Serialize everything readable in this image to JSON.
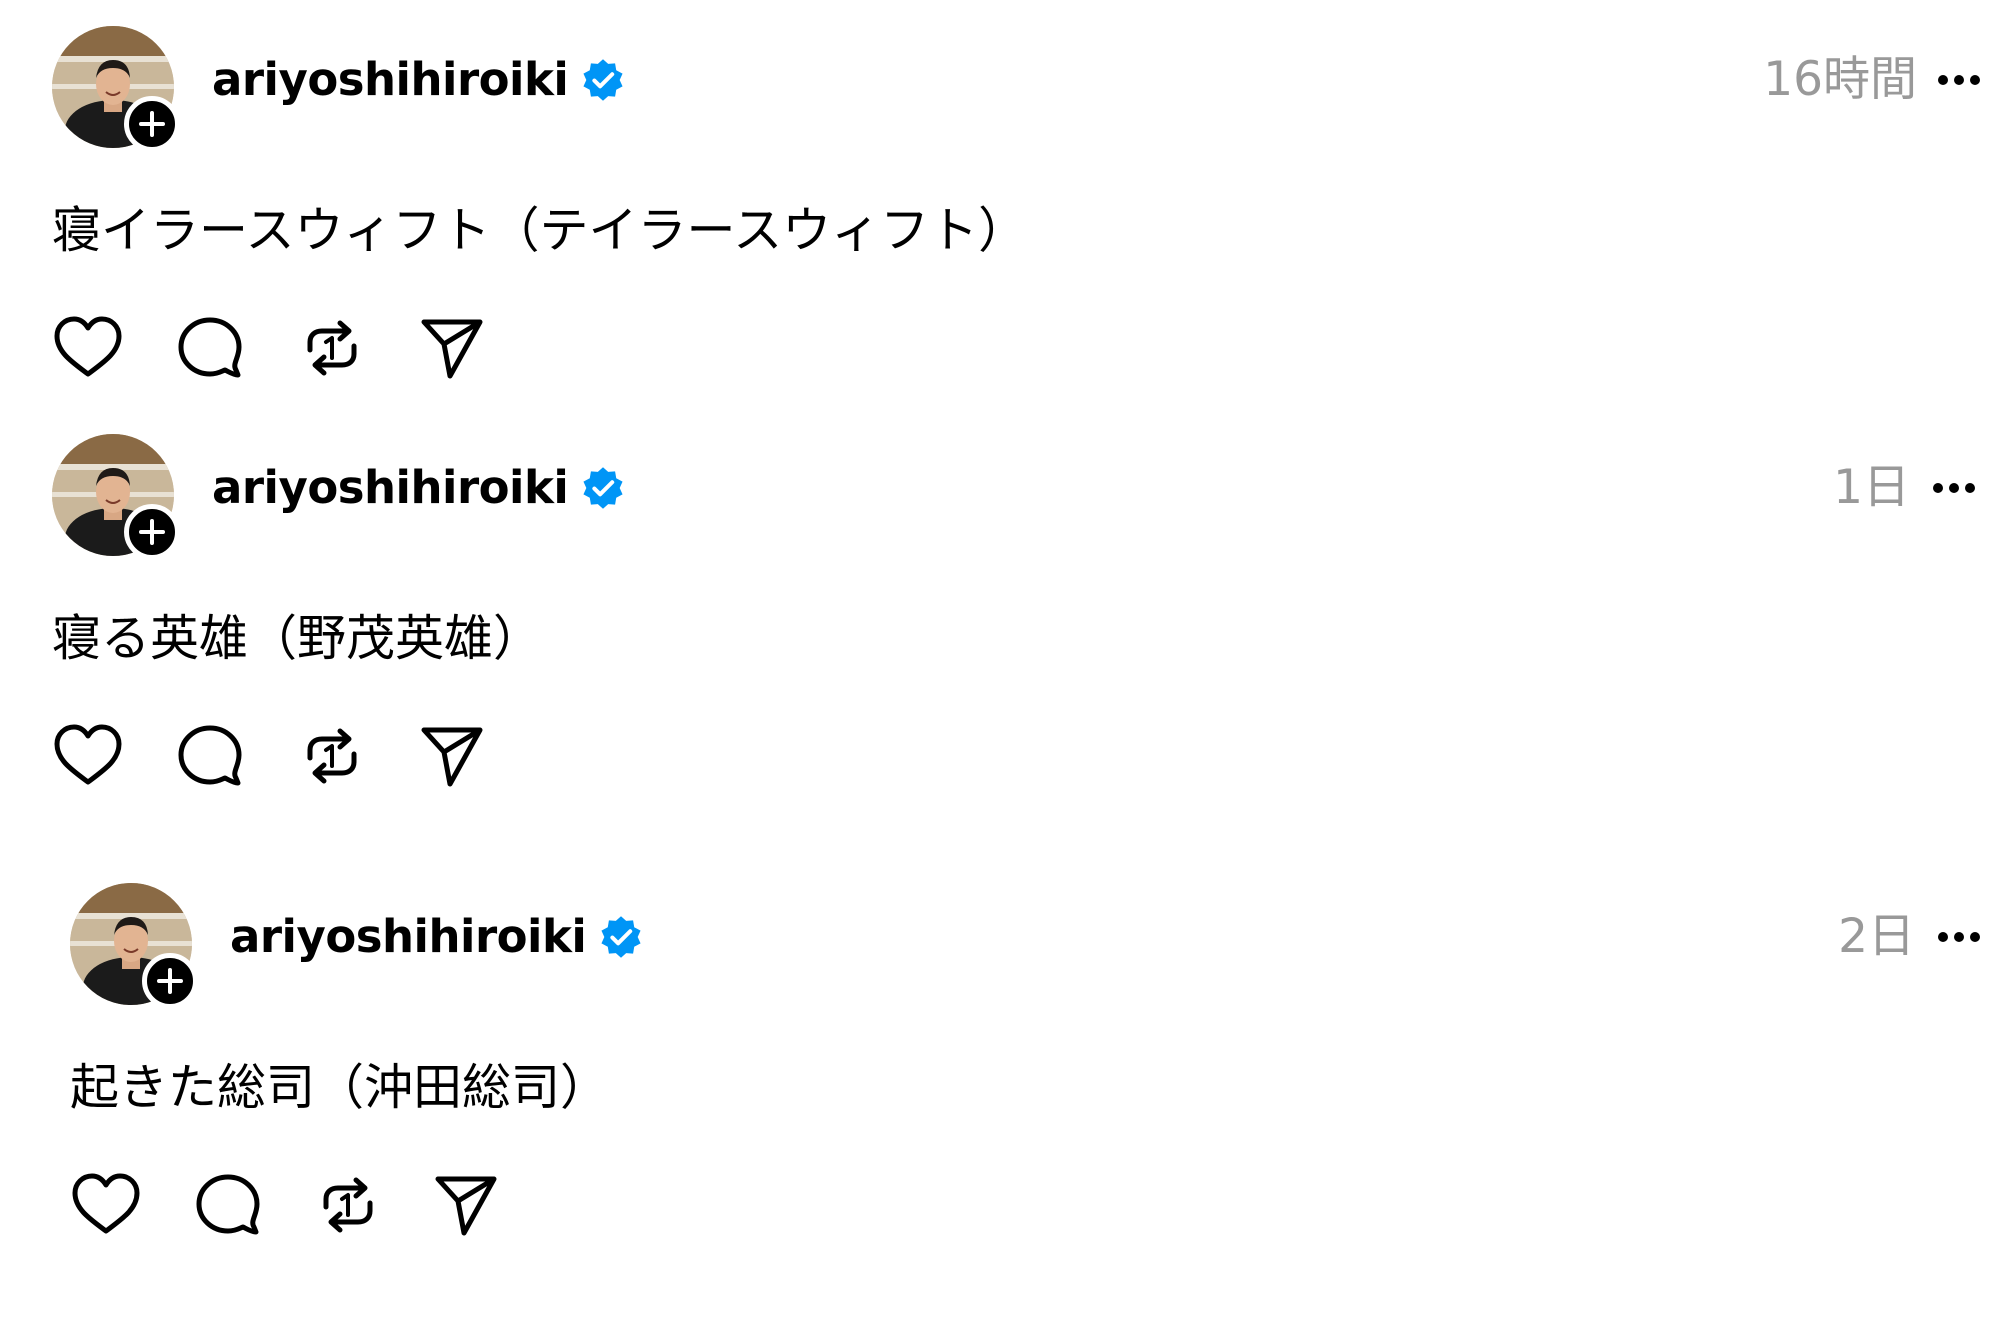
{
  "posts": [
    {
      "username": "ariyoshihiroiki",
      "verified": true,
      "timestamp": "16時間",
      "text": "寝イラースウィフト（テイラースウィフト）"
    },
    {
      "username": "ariyoshihiroiki",
      "verified": true,
      "timestamp": "1日",
      "text": "寝る英雄（野茂英雄）"
    },
    {
      "username": "ariyoshihiroiki",
      "verified": true,
      "timestamp": "2日",
      "text": "起きた総司（沖田総司）"
    }
  ],
  "icons": {
    "avatar": "profile-photo",
    "follow": "plus-icon",
    "verified": "verified-badge-icon",
    "more": "more-options-icon",
    "like": "heart-icon",
    "reply": "comment-bubble-icon",
    "repost": "repost-icon",
    "share": "send-icon"
  },
  "colors": {
    "verified": "#0095f6",
    "timestamp": "#999999",
    "text": "#000000"
  }
}
